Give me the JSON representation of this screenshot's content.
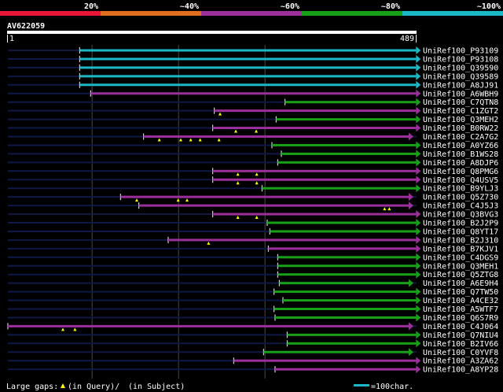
{
  "chart_data": {
    "type": "alignment",
    "query": {
      "accession": "AV622059",
      "start_label": "1",
      "end_label": "489"
    },
    "identity_legend": [
      {
        "label": "20%",
        "color": "#e8173a"
      },
      {
        "label": "~40%",
        "color": "#e07020"
      },
      {
        "label": "~60%",
        "color": "#9b2f9b"
      },
      {
        "label": "~80%",
        "color": "#19a019"
      },
      {
        "label": "~100%",
        "color": "#1bb8c8"
      }
    ],
    "hits": [
      {
        "name": "UniRef100_P93109",
        "start": 137,
        "end": 779,
        "color": "#1bb8c8",
        "gaps": []
      },
      {
        "name": "UniRef100_P93108",
        "start": 137,
        "end": 779,
        "color": "#1bb8c8",
        "gaps": []
      },
      {
        "name": "UniRef100_Q39590",
        "start": 137,
        "end": 779,
        "color": "#1bb8c8",
        "gaps": []
      },
      {
        "name": "UniRef100_Q39589",
        "start": 137,
        "end": 779,
        "color": "#1bb8c8",
        "gaps": []
      },
      {
        "name": "UniRef100_A8JJ91",
        "start": 137,
        "end": 779,
        "color": "#1bb8c8",
        "gaps": []
      },
      {
        "name": "UniRef100_A6WBH9",
        "start": 158,
        "end": 779,
        "color": "#9b2f9b",
        "gaps": []
      },
      {
        "name": "UniRef100_C7QTN8",
        "start": 529,
        "end": 779,
        "color": "#19a019",
        "gaps": []
      },
      {
        "name": "UniRef100_C1ZGT2",
        "start": 394,
        "end": 779,
        "color": "#9b2f9b",
        "gaps": [
          405
        ]
      },
      {
        "name": "UniRef100_Q3MEH2",
        "start": 512,
        "end": 779,
        "color": "#19a019",
        "gaps": []
      },
      {
        "name": "UniRef100_B0RW22",
        "start": 391,
        "end": 779,
        "color": "#9b2f9b",
        "gaps": [
          435,
          474
        ]
      },
      {
        "name": "UniRef100_C2A7G2",
        "start": 259,
        "end": 765,
        "color": "#9b2f9b",
        "gaps": [
          289,
          330,
          349,
          367,
          403
        ]
      },
      {
        "name": "UniRef100_A0YZ66",
        "start": 504,
        "end": 779,
        "color": "#19a019",
        "gaps": []
      },
      {
        "name": "UniRef100_B1WS28",
        "start": 522,
        "end": 779,
        "color": "#19a019",
        "gaps": []
      },
      {
        "name": "UniRef100_A8DJP6",
        "start": 515,
        "end": 779,
        "color": "#19a019",
        "gaps": []
      },
      {
        "name": "UniRef100_Q8PMG6",
        "start": 391,
        "end": 779,
        "color": "#9b2f9b",
        "gaps": [
          439,
          475
        ]
      },
      {
        "name": "UniRef100_Q4USV5",
        "start": 391,
        "end": 779,
        "color": "#9b2f9b",
        "gaps": [
          439,
          475
        ]
      },
      {
        "name": "UniRef100_B9YLJ3",
        "start": 485,
        "end": 779,
        "color": "#19a019",
        "gaps": []
      },
      {
        "name": "UniRef100_Q5Z730",
        "start": 215,
        "end": 765,
        "color": "#9b2f9b",
        "gaps": [
          246,
          325,
          342
        ]
      },
      {
        "name": "UniRef100_C4J5J3",
        "start": 250,
        "end": 765,
        "color": "#9b2f9b",
        "gaps": [
          719,
          728
        ]
      },
      {
        "name": "UniRef100_Q3BVG3",
        "start": 391,
        "end": 779,
        "color": "#9b2f9b",
        "gaps": [
          439,
          475
        ]
      },
      {
        "name": "UniRef100_B2J2P9",
        "start": 495,
        "end": 779,
        "color": "#19a019",
        "gaps": []
      },
      {
        "name": "UniRef100_Q8YT17",
        "start": 500,
        "end": 779,
        "color": "#19a019",
        "gaps": []
      },
      {
        "name": "UniRef100_B2J310",
        "start": 306,
        "end": 779,
        "color": "#9b2f9b",
        "gaps": [
          383
        ]
      },
      {
        "name": "UniRef100_B7KJV1",
        "start": 497,
        "end": 779,
        "color": "#9b2f9b",
        "gaps": []
      },
      {
        "name": "UniRef100_C4DGS9",
        "start": 515,
        "end": 779,
        "color": "#19a019",
        "gaps": []
      },
      {
        "name": "UniRef100_Q3MEH1",
        "start": 515,
        "end": 779,
        "color": "#19a019",
        "gaps": []
      },
      {
        "name": "UniRef100_Q5ZTG8",
        "start": 515,
        "end": 779,
        "color": "#19a019",
        "gaps": []
      },
      {
        "name": "UniRef100_A6E9H4",
        "start": 518,
        "end": 765,
        "color": "#19a019",
        "gaps": []
      },
      {
        "name": "UniRef100_Q7TW50",
        "start": 508,
        "end": 779,
        "color": "#19a019",
        "gaps": []
      },
      {
        "name": "UniRef100_A4CE32",
        "start": 525,
        "end": 779,
        "color": "#19a019",
        "gaps": []
      },
      {
        "name": "UniRef100_A5WTF7",
        "start": 508,
        "end": 779,
        "color": "#19a019",
        "gaps": []
      },
      {
        "name": "UniRef100_Q6S7R9",
        "start": 510,
        "end": 779,
        "color": "#19a019",
        "gaps": []
      },
      {
        "name": "UniRef100_C4J064",
        "start": 0,
        "end": 765,
        "color": "#9b2f9b",
        "gaps": [
          105,
          128
        ]
      },
      {
        "name": "UniRef100_Q7NIU4",
        "start": 533,
        "end": 779,
        "color": "#19a019",
        "gaps": []
      },
      {
        "name": "UniRef100_B2IV66",
        "start": 533,
        "end": 779,
        "color": "#19a019",
        "gaps": []
      },
      {
        "name": "UniRef100_C0YVF8",
        "start": 488,
        "end": 765,
        "color": "#19a019",
        "gaps": []
      },
      {
        "name": "UniRef100_A3ZA62",
        "start": 431,
        "end": 779,
        "color": "#9b2f9b",
        "gaps": []
      },
      {
        "name": "UniRef100_A8YP28",
        "start": 510,
        "end": 779,
        "color": "#9b2f9b",
        "gaps": []
      }
    ],
    "footer": {
      "gaps_label": "Large gaps:",
      "in_query": "(in Query)/",
      "in_subject": "(in Subject)",
      "scale_label": "=100char."
    }
  }
}
